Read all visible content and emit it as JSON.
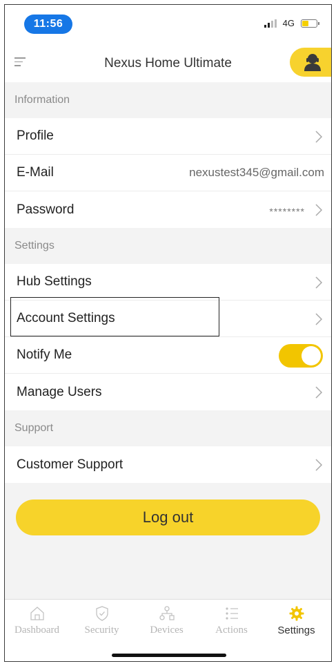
{
  "status_bar": {
    "time": "11:56",
    "network": "4G",
    "battery_color": "#f5d000"
  },
  "header": {
    "title": "Nexus Home Ultimate",
    "menu_icon": "hamburger-icon",
    "avatar_icon": "user-avatar-icon"
  },
  "sections": {
    "information": {
      "heading": "Information",
      "profile_label": "Profile",
      "email_label": "E-Mail",
      "email_value": "nexustest345@gmail.com",
      "password_label": "Password",
      "password_value": "********"
    },
    "settings": {
      "heading": "Settings",
      "hub_label": "Hub Settings",
      "account_label": "Account Settings",
      "notify_label": "Notify Me",
      "notify_on": true,
      "manage_users_label": "Manage Users"
    },
    "support": {
      "heading": "Support",
      "customer_support_label": "Customer Support"
    }
  },
  "logout_label": "Log out",
  "tabs": [
    {
      "label": "Dashboard",
      "icon": "home-icon",
      "active": false
    },
    {
      "label": "Security",
      "icon": "shield-icon",
      "active": false
    },
    {
      "label": "Devices",
      "icon": "devices-icon",
      "active": false
    },
    {
      "label": "Actions",
      "icon": "list-icon",
      "active": false
    },
    {
      "label": "Settings",
      "icon": "gear-icon",
      "active": true
    }
  ],
  "colors": {
    "accent": "#f7d32a",
    "time_pill": "#1677e6"
  }
}
